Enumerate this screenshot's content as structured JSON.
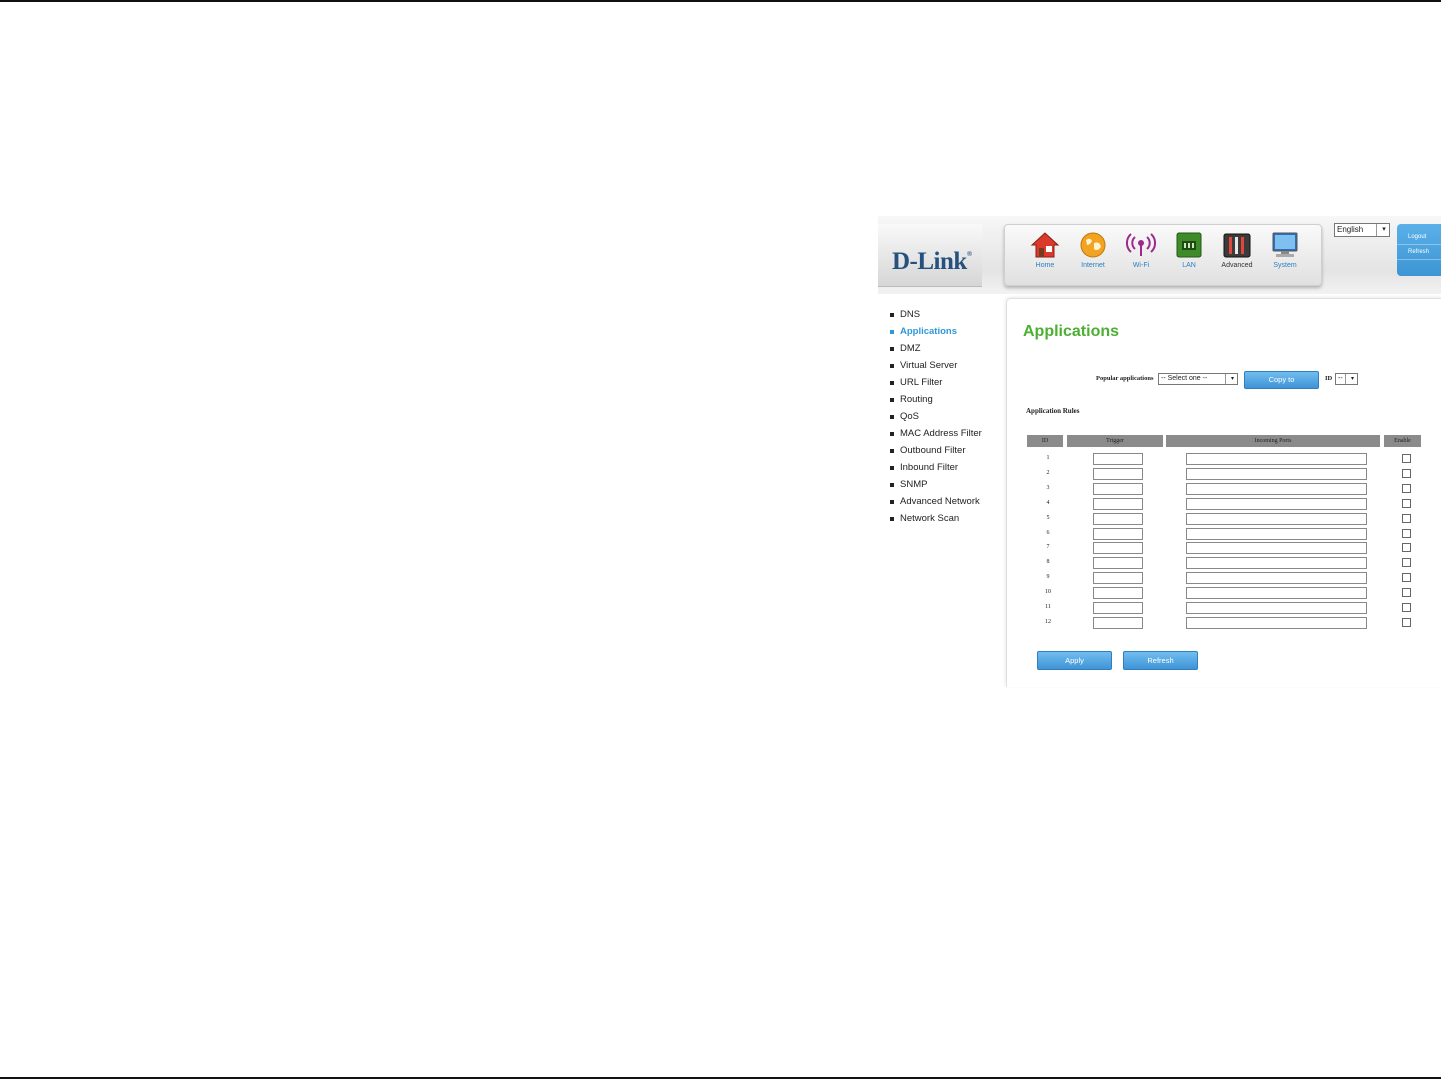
{
  "header": {
    "logo": "D-Link",
    "logo_mark": "®",
    "nav": [
      {
        "label": "Home",
        "icon": "home-icon"
      },
      {
        "label": "Internet",
        "icon": "globe-icon"
      },
      {
        "label": "Wi-Fi",
        "icon": "wifi-icon"
      },
      {
        "label": "LAN",
        "icon": "lan-icon"
      },
      {
        "label": "Advanced",
        "icon": "advanced-tools-icon"
      },
      {
        "label": "System",
        "icon": "monitor-icon"
      }
    ],
    "language": "English",
    "logout_label": "Logout",
    "refresh_label": "Refresh"
  },
  "sidebar": {
    "items": [
      {
        "label": "DNS"
      },
      {
        "label": "Applications",
        "active": true
      },
      {
        "label": "DMZ"
      },
      {
        "label": "Virtual Server"
      },
      {
        "label": "URL Filter"
      },
      {
        "label": "Routing"
      },
      {
        "label": "QoS"
      },
      {
        "label": "MAC Address Filter"
      },
      {
        "label": "Outbound Filter"
      },
      {
        "label": "Inbound Filter"
      },
      {
        "label": "SNMP"
      },
      {
        "label": "Advanced Network"
      },
      {
        "label": "Network Scan"
      }
    ]
  },
  "main": {
    "title": "Applications",
    "popular_label": "Popular applications",
    "popular_select": "-- Select one --",
    "copy_label": "Copy to",
    "id_label": "ID",
    "id_select": "--",
    "rules_title": "Application Rules",
    "columns": [
      "ID",
      "Trigger",
      "Incoming Ports",
      "Enable"
    ],
    "rows": [
      {
        "id": "1"
      },
      {
        "id": "2"
      },
      {
        "id": "3"
      },
      {
        "id": "4"
      },
      {
        "id": "5"
      },
      {
        "id": "6"
      },
      {
        "id": "7"
      },
      {
        "id": "8"
      },
      {
        "id": "9"
      },
      {
        "id": "10"
      },
      {
        "id": "11"
      },
      {
        "id": "12"
      }
    ],
    "apply_label": "Apply",
    "refresh_label": "Refresh"
  },
  "colors": {
    "title_green": "#4caf32",
    "link_blue": "#2c9ad8",
    "button_blue": "#3f94d6",
    "logo_blue": "#24517e",
    "header_gray": "#8b8b8b"
  }
}
